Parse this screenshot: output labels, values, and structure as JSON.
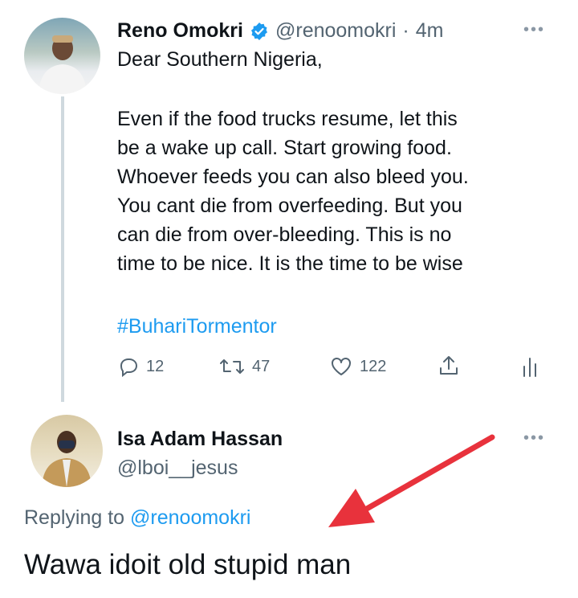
{
  "tweet": {
    "author_name": "Reno Omokri",
    "handle": "@renoomokri",
    "separator": "·",
    "time": "4m",
    "verified": true,
    "lines": [
      "Dear Southern Nigeria,",
      "",
      "Even if the food trucks resume, let this",
      "be a wake up call. Start growing food.",
      "Whoever feeds you can also bleed you.",
      "You cant die from overfeeding. But you",
      "can die from over-bleeding. This is no",
      "time to be nice. It is the time to be wise"
    ],
    "hashtag": "#BuhariTormentor",
    "actions": {
      "replies": "12",
      "retweets": "47",
      "likes": "122"
    },
    "icons": [
      "reply-icon",
      "retweet-icon",
      "like-icon",
      "share-icon",
      "analytics-icon",
      "more-icon"
    ]
  },
  "reply": {
    "author_name": "Isa Adam Hassan",
    "handle": "@lboi__jesus",
    "replying_prefix": "Replying to ",
    "replying_to": "@renoomokri",
    "text": "Wawa idoit old stupid man"
  },
  "annotation": {
    "arrow_color": "#e8323c"
  },
  "colors": {
    "accent": "#1d9bf0",
    "muted": "#536471",
    "text": "#0f1419"
  }
}
